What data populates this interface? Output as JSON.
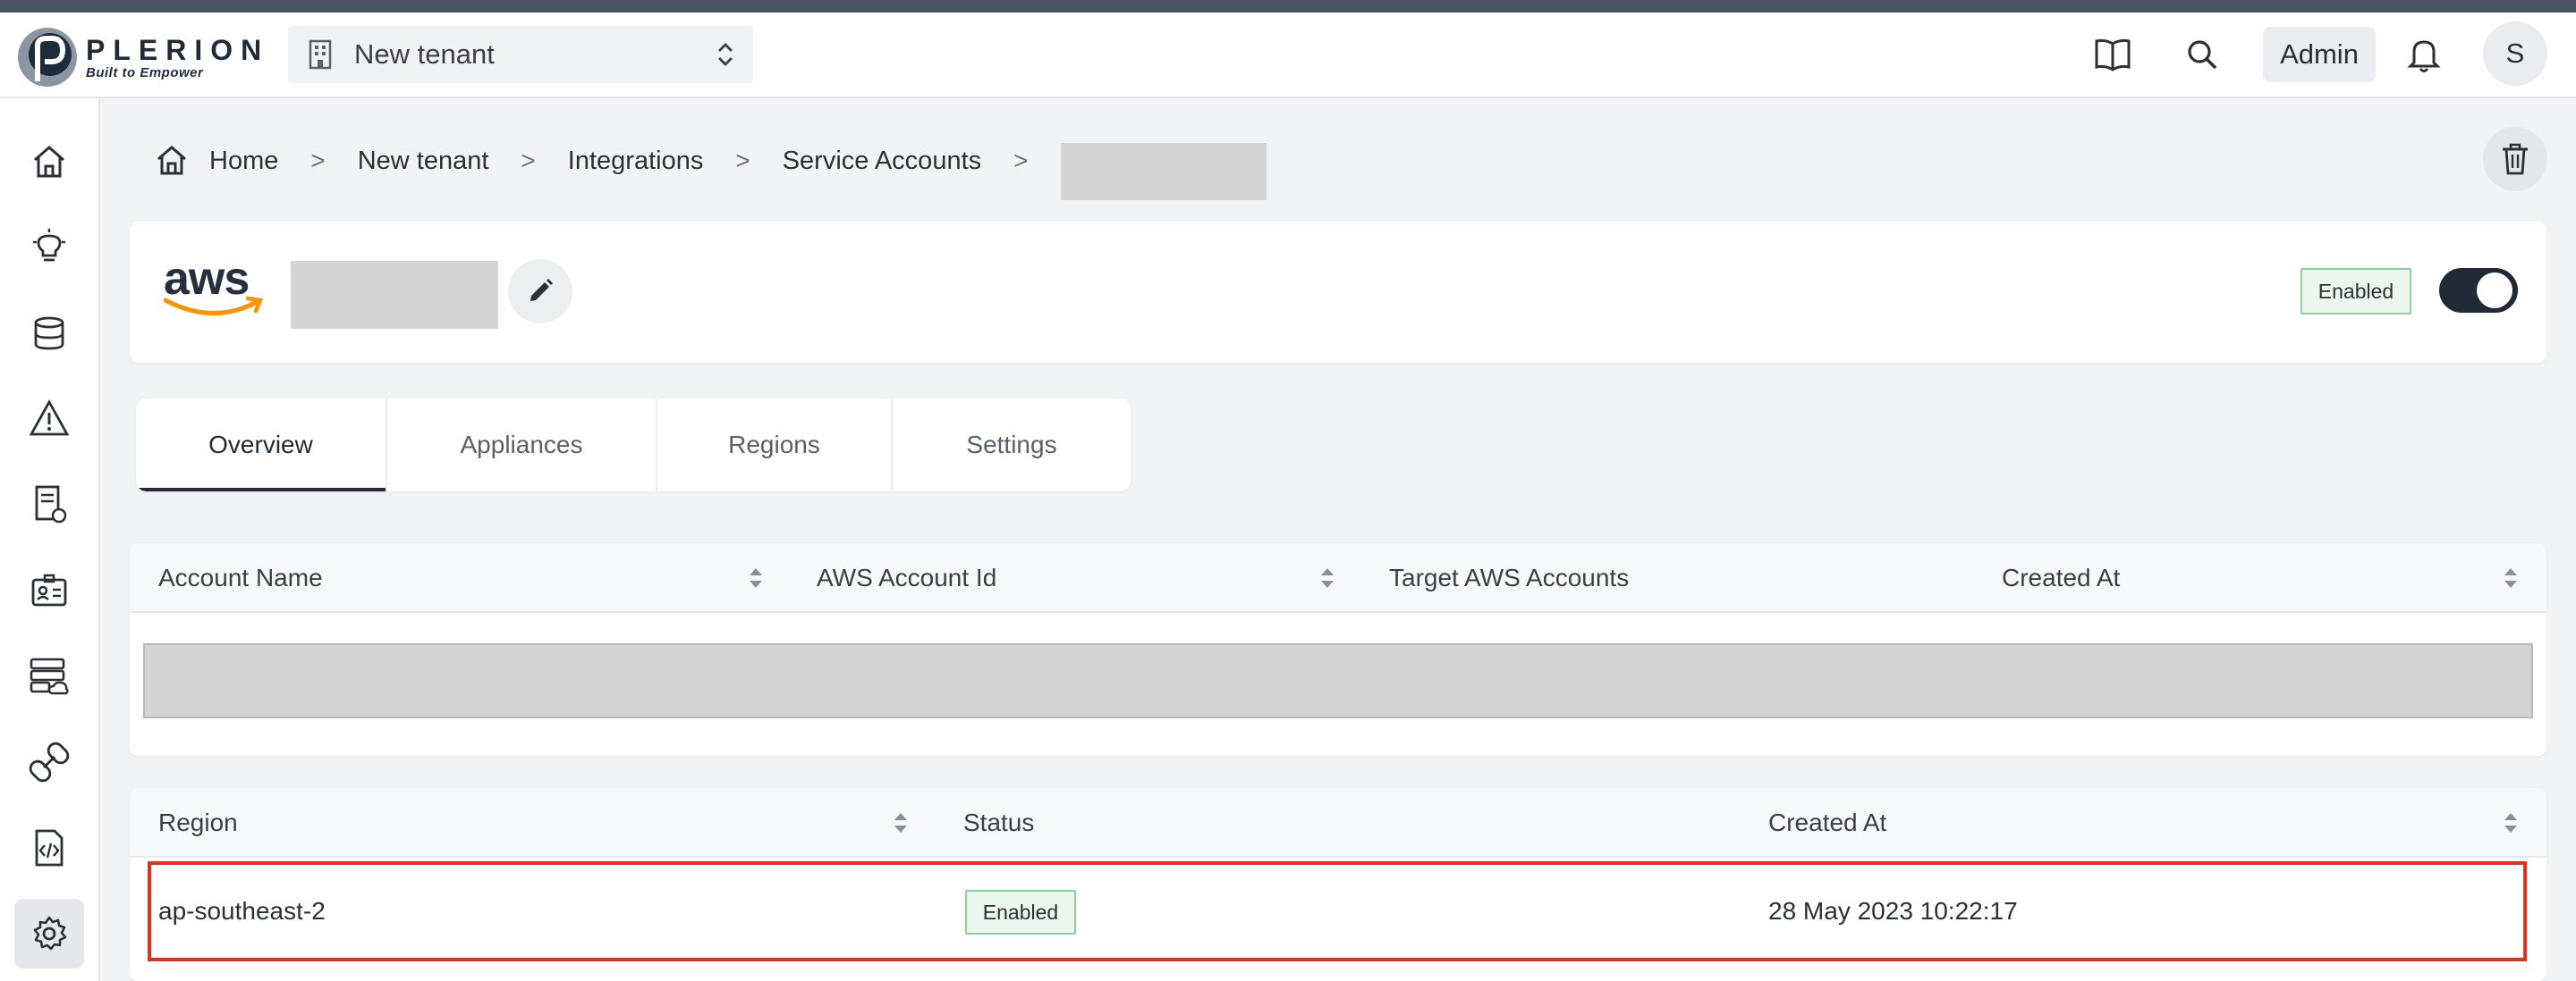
{
  "header": {
    "logo_name": "PLERION",
    "logo_tagline": "Built to Empower",
    "tenant_selector": "New tenant",
    "admin_label": "Admin",
    "avatar_initial": "S"
  },
  "sidebar": {
    "items": [
      "home",
      "insights",
      "inventory",
      "risks",
      "compliance",
      "identities",
      "assets",
      "integrations",
      "policies",
      "settings"
    ],
    "active": "settings"
  },
  "breadcrumb": {
    "items": [
      "Home",
      "New tenant",
      "Integrations",
      "Service Accounts"
    ],
    "separator": ">"
  },
  "account": {
    "provider_logo": "aws",
    "status_label": "Enabled",
    "toggle_on": true
  },
  "tabs": [
    {
      "label": "Overview",
      "active": true
    },
    {
      "label": "Appliances",
      "active": false
    },
    {
      "label": "Regions",
      "active": false
    },
    {
      "label": "Settings",
      "active": false
    }
  ],
  "accounts_table": {
    "columns": [
      "Account Name",
      "AWS Account Id",
      "Target AWS Accounts",
      "Created At"
    ]
  },
  "regions_table": {
    "columns": [
      "Region",
      "Status",
      "Created At"
    ],
    "rows": [
      {
        "region": "ap-southeast-2",
        "status": "Enabled",
        "created_at": "28 May 2023 10:22:17"
      }
    ]
  },
  "colors": {
    "accent_dark": "#1f2a36",
    "enabled_green": "#8fd19e",
    "highlight_red": "#e0301e"
  }
}
